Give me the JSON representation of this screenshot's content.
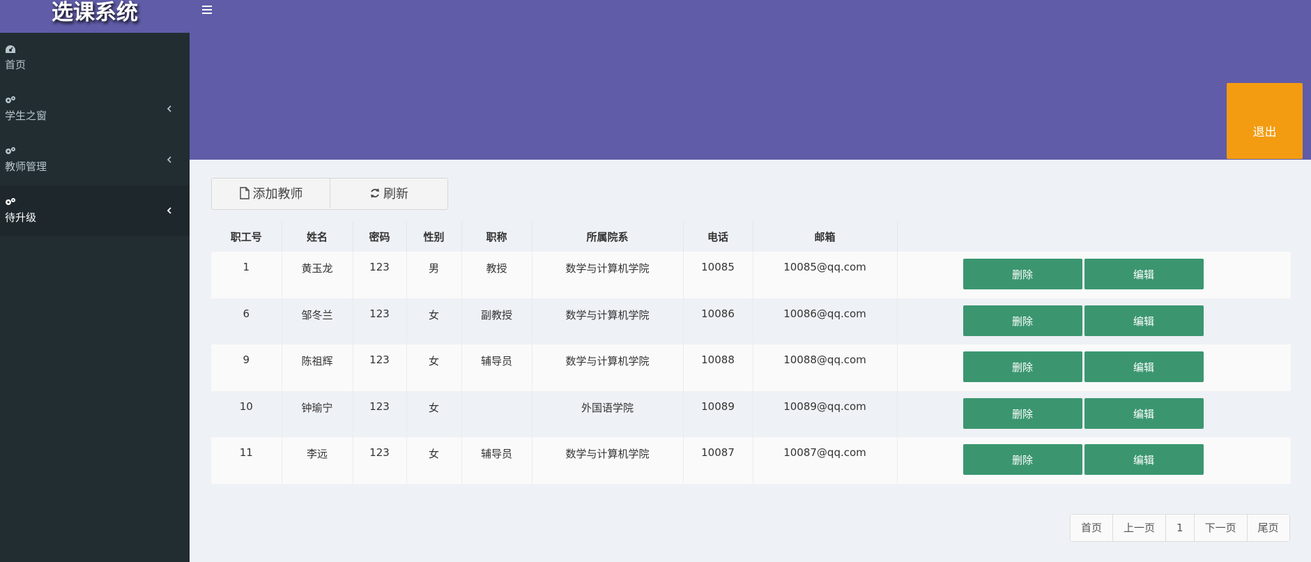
{
  "app": {
    "title": "选课系统"
  },
  "sidebar": {
    "items": [
      {
        "label": "首页",
        "icon": "dashboard-icon"
      },
      {
        "label": "学生之窗",
        "icon": "gears-icon"
      },
      {
        "label": "教师管理",
        "icon": "gears-icon"
      },
      {
        "label": "待升级",
        "icon": "gears-icon",
        "active": true
      }
    ]
  },
  "header": {
    "logout_label": "退出"
  },
  "toolbar": {
    "add_label": "添加教师",
    "refresh_label": "刷新"
  },
  "table": {
    "columns": [
      "职工号",
      "姓名",
      "密码",
      "性别",
      "职称",
      "所属院系",
      "电话",
      "邮箱",
      ""
    ],
    "rows": [
      {
        "id": "1",
        "name": "黄玉龙",
        "password": "123",
        "gender": "男",
        "title": "教授",
        "dept": "数学与计算机学院",
        "phone": "10085",
        "email": "10085@qq.com"
      },
      {
        "id": "6",
        "name": "邹冬兰",
        "password": "123",
        "gender": "女",
        "title": "副教授",
        "dept": "数学与计算机学院",
        "phone": "10086",
        "email": "10086@qq.com"
      },
      {
        "id": "9",
        "name": "陈祖辉",
        "password": "123",
        "gender": "女",
        "title": "辅导员",
        "dept": "数学与计算机学院",
        "phone": "10088",
        "email": "10088@qq.com"
      },
      {
        "id": "10",
        "name": "钟瑜宁",
        "password": "123",
        "gender": "女",
        "title": "",
        "dept": "外国语学院",
        "phone": "10089",
        "email": "10089@qq.com"
      },
      {
        "id": "11",
        "name": "李远",
        "password": "123",
        "gender": "女",
        "title": "辅导员",
        "dept": "数学与计算机学院",
        "phone": "10087",
        "email": "10087@qq.com"
      }
    ],
    "delete_label": "删除",
    "edit_label": "编辑"
  },
  "pagination": {
    "first": "首页",
    "prev": "上一页",
    "current": "1",
    "next": "下一页",
    "last": "尾页"
  },
  "colors": {
    "header": "#605ca8",
    "sidebar": "#222d32",
    "logout": "#f39c12",
    "action": "#3b9670"
  }
}
